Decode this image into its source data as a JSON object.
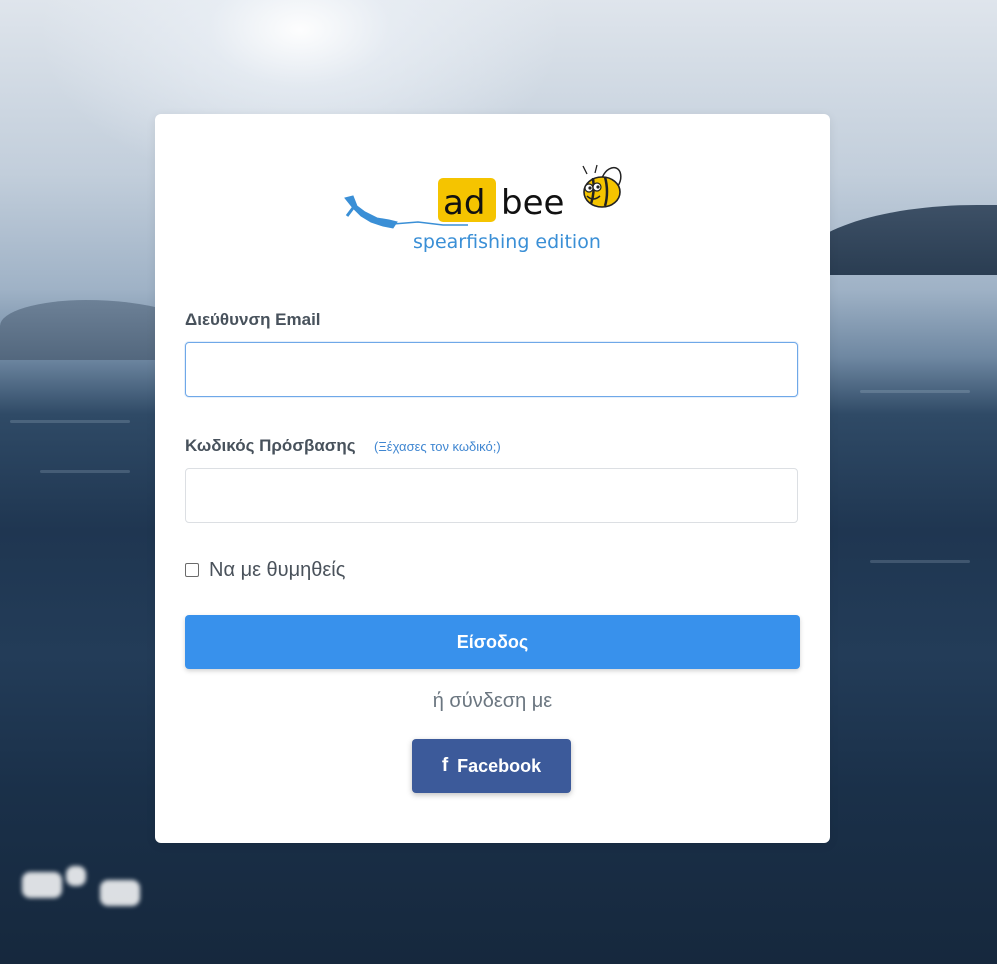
{
  "logo": {
    "word_ad": "ad",
    "word_bee": "bee",
    "tagline": "spearfishing edition"
  },
  "form": {
    "email_label": "Διεύθυνση Email",
    "email_value": "",
    "email_placeholder": "",
    "password_label": "Κωδικός Πρόσβασης",
    "forgot_link": "(Ξέχασες τον κωδικό;)",
    "password_value": "",
    "password_placeholder": "",
    "remember_label": "Να με θυμηθείς",
    "remember_checked": false,
    "login_button": "Είσοδος",
    "or_text": "ή σύνδεση με",
    "facebook_icon": "f",
    "facebook_button": "Facebook"
  },
  "colors": {
    "primary": "#3891ec",
    "facebook": "#3c5a9a",
    "link": "#3f86d1",
    "logo_yellow": "#f5c400",
    "logo_blue": "#3a8fd6"
  },
  "icons": {
    "logo_figure": "spearfisher-diver-icon",
    "logo_mascot": "bee-mascot-icon",
    "facebook": "facebook-f-icon"
  }
}
